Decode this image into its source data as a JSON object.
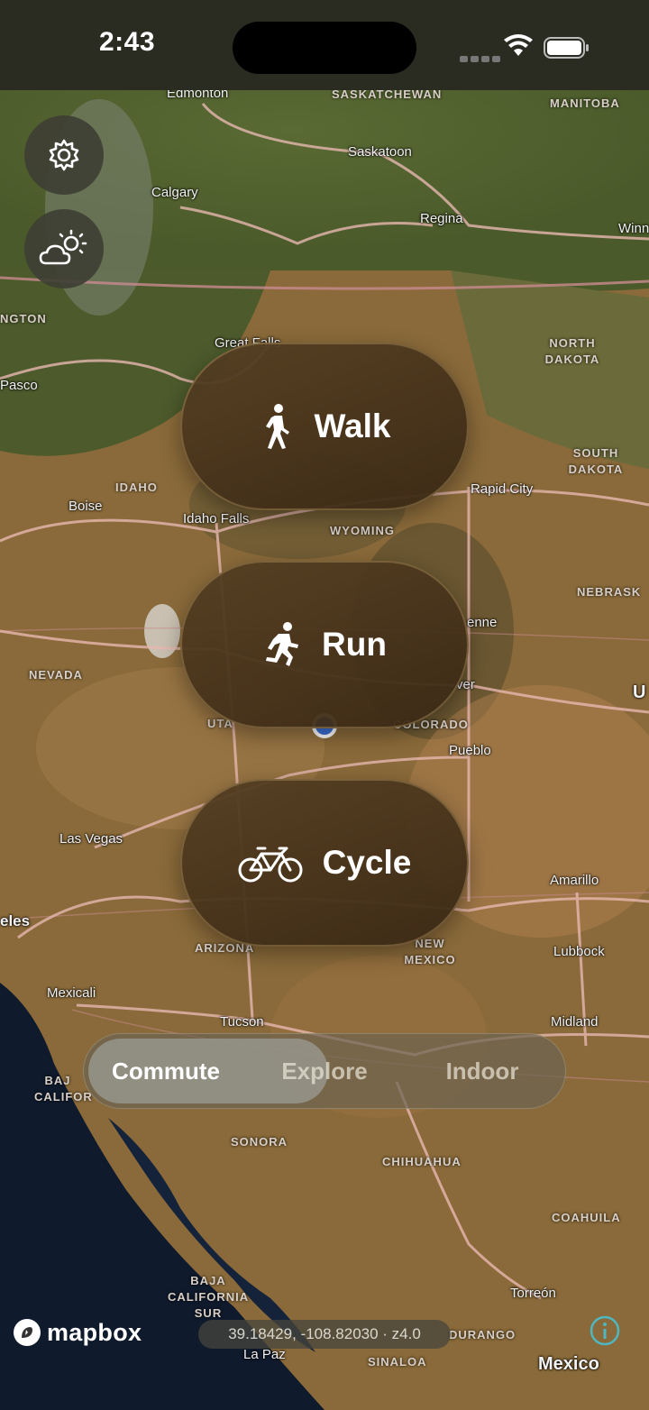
{
  "status_bar": {
    "time": "2:43"
  },
  "controls": {
    "settings": "gear-icon",
    "weather": "partly-cloudy-sun-icon"
  },
  "modes": [
    {
      "label": "Walk",
      "icon": "walking-person-icon"
    },
    {
      "label": "Run",
      "icon": "running-person-icon"
    },
    {
      "label": "Cycle",
      "icon": "bicycle-icon"
    }
  ],
  "segments": {
    "items": [
      "Commute",
      "Explore",
      "Indoor"
    ],
    "selected": "Commute"
  },
  "map": {
    "attribution": "mapbox",
    "coordinates": "39.18429, -108.82030 · z4.0",
    "cities": [
      "Edmonton",
      "Saskatoon",
      "Calgary",
      "Regina",
      "Winn",
      "Pasco",
      "Great Falls",
      "Boise",
      "Idaho Falls",
      "Rapid City",
      "enne",
      "ver",
      "Pueblo",
      "Las Vegas",
      "Amarillo",
      "eles",
      "Lubbock",
      "Mexicali",
      "Tucson",
      "Midland",
      "Torreón",
      "La Paz",
      "Mexico",
      "U"
    ],
    "regions": [
      "SASKATCHEWAN",
      "MANITOBA",
      "NGTON",
      "NORTH DAKOTA",
      "SOUTH DAKOTA",
      "IDAHO",
      "WYOMING",
      "NEBRASK",
      "NEVADA",
      "UTA",
      "COLORADO",
      "ARIZONA",
      "NEW MEXICO",
      "BAJ CALIFOR",
      "SONORA",
      "CHIHUAHUA",
      "COAHUILA",
      "BAJA CALIFORNIA SUR",
      "DURANGO",
      "SINALOA"
    ]
  },
  "colors": {
    "accent_location": "#3b6fd8",
    "mode_button": "#4a3620"
  }
}
